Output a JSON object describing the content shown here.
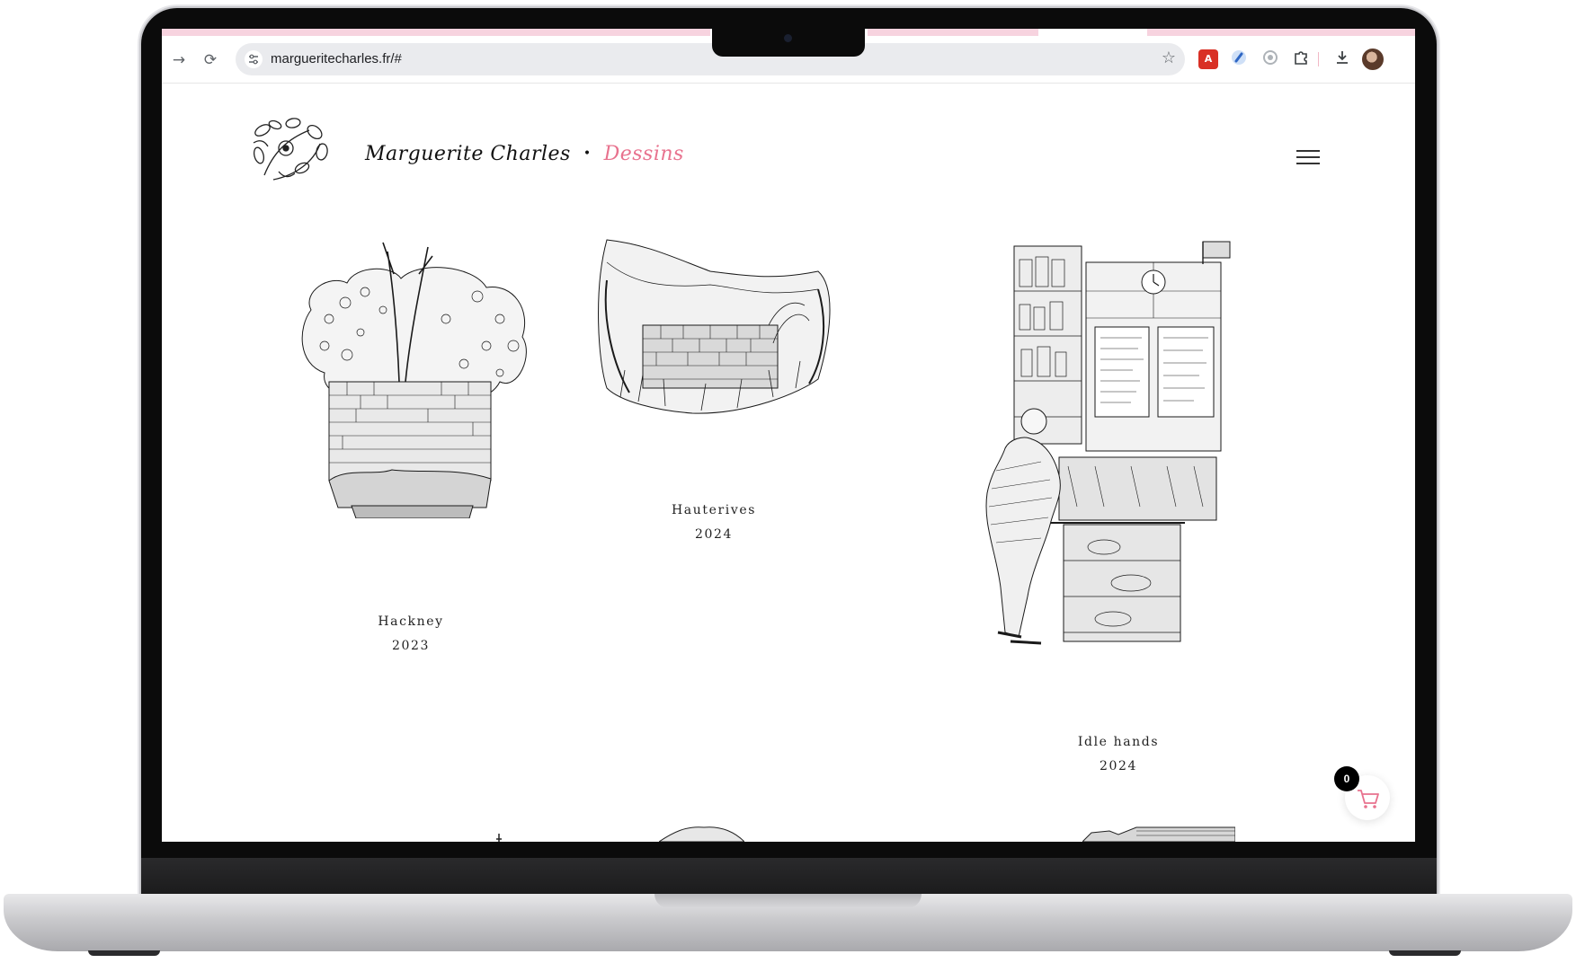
{
  "browser": {
    "url": "margueritecharles.fr/#",
    "nav_forward": "→",
    "reload": "⟳",
    "site_info_icon": "tune-icon",
    "bookmark_icon": "star-icon",
    "extensions": [
      "pdf-extension-icon",
      "blue-extension-icon",
      "gray-extension-icon",
      "puzzle-icon",
      "download-icon",
      "profile-avatar"
    ]
  },
  "site": {
    "brand_name": "Marguerite Charles",
    "brand_separator": "•",
    "brand_section": "Dessins",
    "accent_color": "#e8728e"
  },
  "gallery": [
    {
      "title": "Hackney",
      "year": "2023",
      "drawing": "tree-over-brick-wall"
    },
    {
      "title": "Hauterives",
      "year": "2024",
      "drawing": "overgrown-stone-wall"
    },
    {
      "title": "Idle hands",
      "year": "2024",
      "drawing": "coffee-kiosk-with-customer"
    }
  ],
  "cart": {
    "count": "0",
    "icon": "shopping-cart-icon"
  }
}
